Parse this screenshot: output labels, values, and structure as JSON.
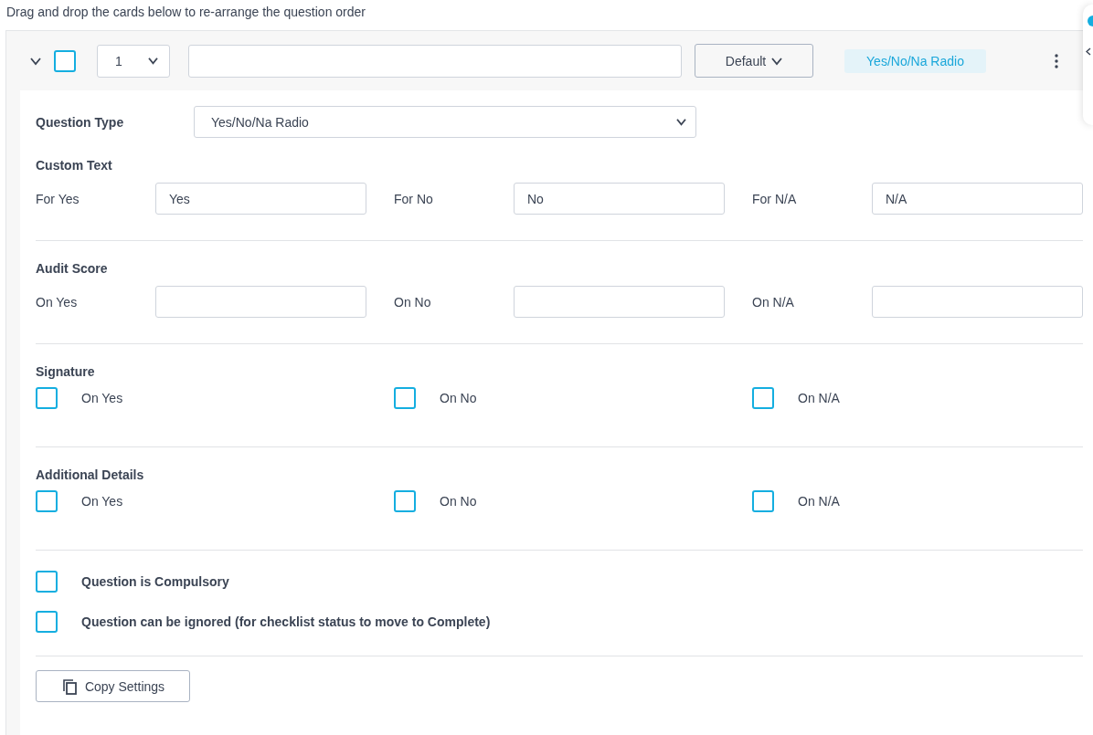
{
  "instruction": "Drag and drop the cards below to re-arrange the question order",
  "header": {
    "expanded": true,
    "selected": false,
    "order": "1",
    "category_button": "Default",
    "type_badge": "Yes/No/Na Radio"
  },
  "question_type": {
    "label": "Question Type",
    "value": "Yes/No/Na Radio"
  },
  "custom_text": {
    "heading": "Custom Text",
    "fields": [
      {
        "label": "For Yes",
        "value": "Yes"
      },
      {
        "label": "For No",
        "value": "No"
      },
      {
        "label": "For N/A",
        "value": "N/A"
      }
    ]
  },
  "audit_score": {
    "heading": "Audit Score",
    "fields": [
      {
        "label": "On Yes"
      },
      {
        "label": "On No"
      },
      {
        "label": "On N/A"
      }
    ]
  },
  "signature": {
    "heading": "Signature",
    "options": [
      {
        "label": "On Yes",
        "checked": false
      },
      {
        "label": "On No",
        "checked": false
      },
      {
        "label": "On N/A",
        "checked": false
      }
    ]
  },
  "additional_details": {
    "heading": "Additional Details",
    "options": [
      {
        "label": "On Yes",
        "checked": false
      },
      {
        "label": "On No",
        "checked": false
      },
      {
        "label": "On N/A",
        "checked": false
      }
    ]
  },
  "flags": [
    {
      "label": "Question is Compulsory",
      "checked": false
    },
    {
      "label": "Question can be ignored (for checklist status to move to Complete)",
      "checked": false
    }
  ],
  "copy_button": "Copy Settings"
}
